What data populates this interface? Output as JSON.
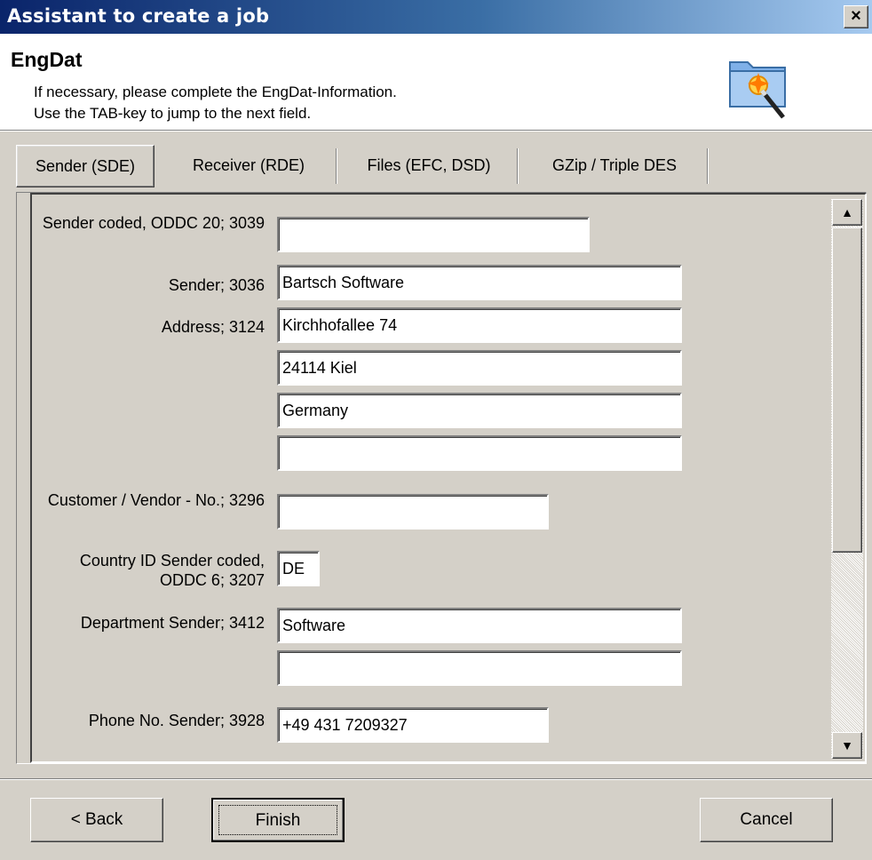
{
  "window": {
    "title": "Assistant to create a job",
    "close_glyph": "×"
  },
  "header": {
    "title": "EngDat",
    "line1": "If necessary, please complete the EngDat-Information.",
    "line2": "Use the TAB-key to jump to the next field.",
    "icon": "folder-wizard-icon"
  },
  "tabs": [
    {
      "label": "Sender (SDE)",
      "selected": true
    },
    {
      "label": "Receiver (RDE)",
      "selected": false
    },
    {
      "label": "Files (EFC, DSD)",
      "selected": false
    },
    {
      "label": "GZip / Triple DES",
      "selected": false
    }
  ],
  "form": {
    "sender_coded": {
      "label": "Sender coded, ODDC 20; 3039",
      "value": ""
    },
    "sender": {
      "label": "Sender; 3036",
      "value": "Bartsch Software"
    },
    "address": {
      "label": "Address; 3124",
      "lines": [
        "Kirchhofallee 74",
        "24114 Kiel",
        "Germany",
        ""
      ]
    },
    "customer_vendor": {
      "label": "Customer / Vendor - No.; 3296",
      "value": ""
    },
    "country_id": {
      "label": "Country ID Sender coded, ODDC 6; 3207",
      "value": "DE"
    },
    "department": {
      "label": "Department Sender; 3412",
      "lines": [
        "Software",
        ""
      ]
    },
    "phone": {
      "label": "Phone No. Sender; 3928",
      "value": "+49 431 7209327"
    }
  },
  "scrollbar": {
    "up_glyph": "▲",
    "down_glyph": "▼"
  },
  "buttons": {
    "back": "< Back",
    "finish": "Finish",
    "cancel": "Cancel"
  }
}
